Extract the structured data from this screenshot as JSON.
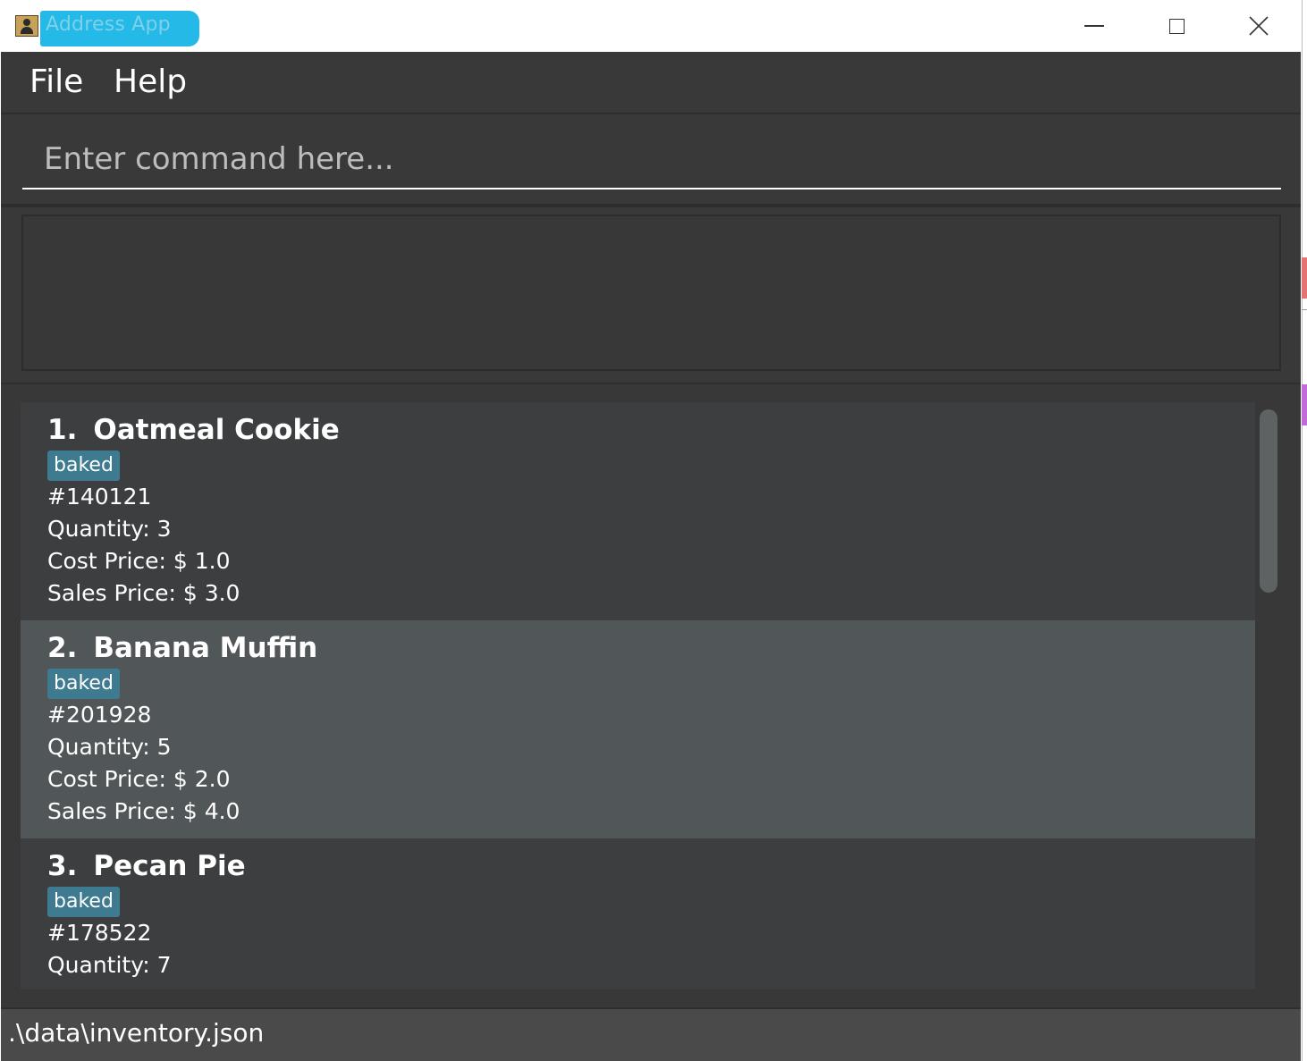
{
  "window": {
    "title": "Address App"
  },
  "menu": {
    "file": "File",
    "help": "Help"
  },
  "command": {
    "placeholder": "Enter command here...",
    "value": ""
  },
  "result": {
    "text": ""
  },
  "items": [
    {
      "index": "1.",
      "name": "Oatmeal Cookie",
      "tag": "baked",
      "code": "#140121",
      "quantity": "Quantity: 3",
      "cost": "Cost Price: $ 1.0",
      "sales": "Sales Price: $ 3.0"
    },
    {
      "index": "2.",
      "name": "Banana Muffin",
      "tag": "baked",
      "code": "#201928",
      "quantity": "Quantity: 5",
      "cost": "Cost Price: $ 2.0",
      "sales": "Sales Price: $ 4.0"
    },
    {
      "index": "3.",
      "name": "Pecan Pie",
      "tag": "baked",
      "code": "#178522",
      "quantity": "Quantity: 7",
      "cost": "",
      "sales": ""
    }
  ],
  "status": {
    "path": ".\\data\\inventory.json"
  },
  "colors": {
    "background": "#383838",
    "card_even": "#3c3e3f",
    "card_selected": "#515658",
    "tag": "#3e7b91",
    "title_highlight": "#25b9e8"
  },
  "icons": {
    "app": "address-book-icon",
    "minimize": "minimize-icon",
    "maximize": "maximize-icon",
    "close": "close-icon"
  }
}
